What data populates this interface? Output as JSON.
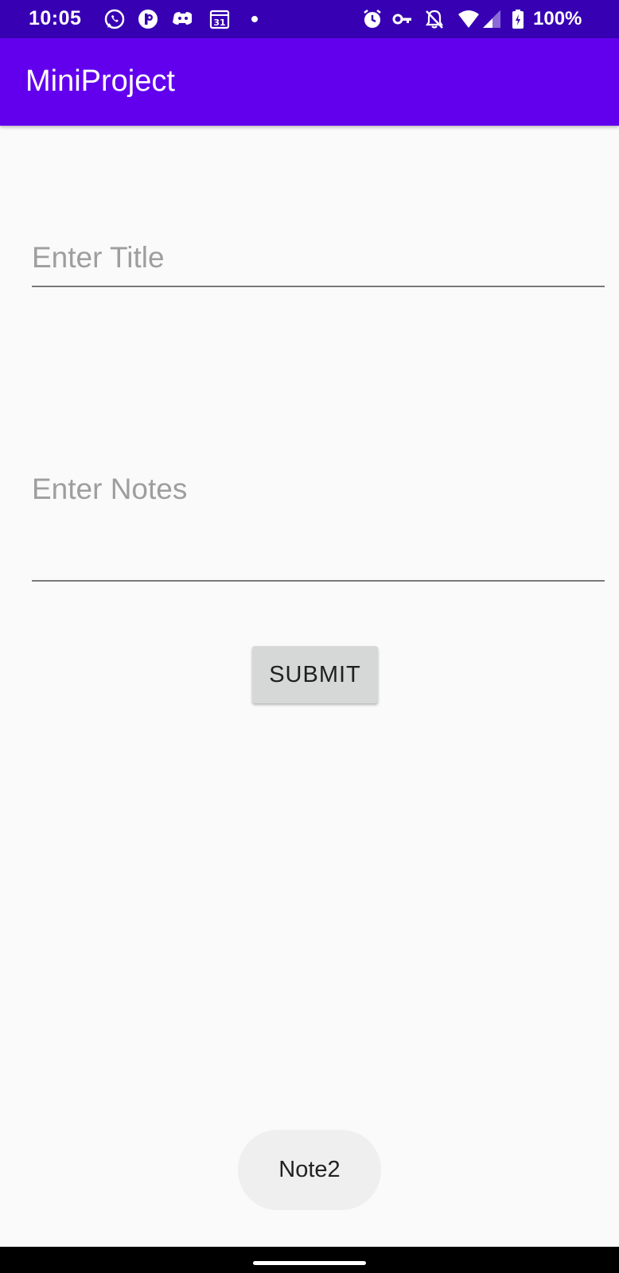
{
  "status_bar": {
    "time": "10:05",
    "battery": "100%",
    "icons": [
      "whatsapp-icon",
      "app-p-icon",
      "discord-icon",
      "calendar-icon",
      "dot-icon",
      "alarm-icon",
      "vpn-key-icon",
      "bell-off-icon",
      "wifi-icon",
      "signal-icon",
      "battery-icon"
    ],
    "calendar_day": "31"
  },
  "app_bar": {
    "title": "MiniProject"
  },
  "form": {
    "title_placeholder": "Enter Title",
    "title_value": "",
    "notes_placeholder": "Enter Notes",
    "notes_value": "",
    "submit_label": "SUBMIT"
  },
  "toast": {
    "text": "Note2"
  },
  "colors": {
    "status_bar": "#3700B3",
    "app_bar": "#6200EE",
    "background": "#FAFAFA",
    "button": "#D6D7D7",
    "toast": "#EFEFEF"
  }
}
